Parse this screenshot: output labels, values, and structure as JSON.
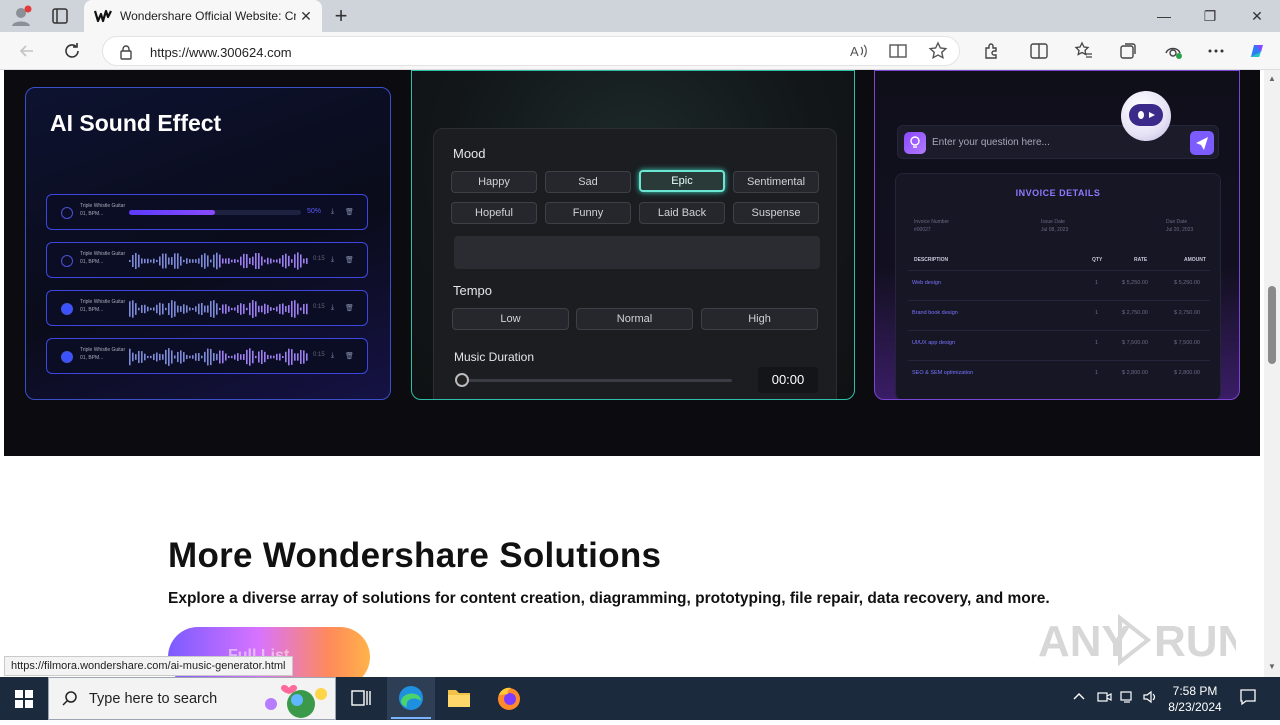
{
  "browser": {
    "tab_title": "Wondershare Official Website: Cr",
    "new_tab": "+",
    "url": "https://www.300624.com",
    "minimize": "—",
    "maximize": "❐",
    "close": "✕"
  },
  "sound_effect_card": {
    "title": "AI Sound Effect",
    "tracks": [
      {
        "name": "Triple Whistle\nGuitar 01, BPM...",
        "progress": 0.5,
        "percent": "50%"
      },
      {
        "name": "Triple Whistle\nGuitar 01, BPM...",
        "time": "0:15"
      },
      {
        "name": "Triple Whistle\nGuitar 01, BPM...",
        "time": "0:15"
      },
      {
        "name": "Triple Whistle\nGuitar 01, BPM...",
        "time": "0:15"
      }
    ]
  },
  "music_card": {
    "mood_label": "Mood",
    "moods": [
      "Happy",
      "Sad",
      "Epic",
      "Sentimental",
      "Hopeful",
      "Funny",
      "Laid Back",
      "Suspense"
    ],
    "active_mood": "Epic",
    "tempo_label": "Tempo",
    "tempos": [
      "Low",
      "Normal",
      "High"
    ],
    "duration_label": "Music Duration",
    "duration_value": "00:00"
  },
  "invoice_card": {
    "ask_placeholder": "Enter your question here...",
    "title": "INVOICE DETAILS",
    "meta": [
      {
        "label": "Invoice Number",
        "value": "#00027"
      },
      {
        "label": "Issue Date",
        "value": "Jul 08, 2023"
      },
      {
        "label": "Due Date",
        "value": "Jul 20, 2023"
      }
    ],
    "headers": [
      "DESCRIPTION",
      "QTY",
      "RATE",
      "AMOUNT"
    ],
    "rows": [
      {
        "desc": "Web design",
        "qty": "1",
        "rate": "$ 5,250.00",
        "amount": "$ 5,250.00"
      },
      {
        "desc": "Brand book design",
        "qty": "1",
        "rate": "$ 2,750.00",
        "amount": "$ 2,750.00"
      },
      {
        "desc": "UI/UX app design",
        "qty": "1",
        "rate": "$ 7,500.00",
        "amount": "$ 7,500.00"
      },
      {
        "desc": "SEO & SEM optimization",
        "qty": "1",
        "rate": "$ 2,800.00",
        "amount": "$ 2,800.00"
      }
    ]
  },
  "solutions": {
    "title": "More Wondershare Solutions",
    "subtitle": "Explore a diverse array of solutions for content creation, diagramming, prototyping, file repair, data recovery, and more.",
    "button_label": "Full List"
  },
  "status_link": "https://filmora.wondershare.com/ai-music-generator.html",
  "taskbar": {
    "search_placeholder": "Type here to search",
    "time": "7:58 PM",
    "date": "8/23/2024"
  },
  "colors": {
    "accent_teal": "#6be6d2",
    "accent_purple": "#7c5cff",
    "track_border": "#3d47e0"
  }
}
